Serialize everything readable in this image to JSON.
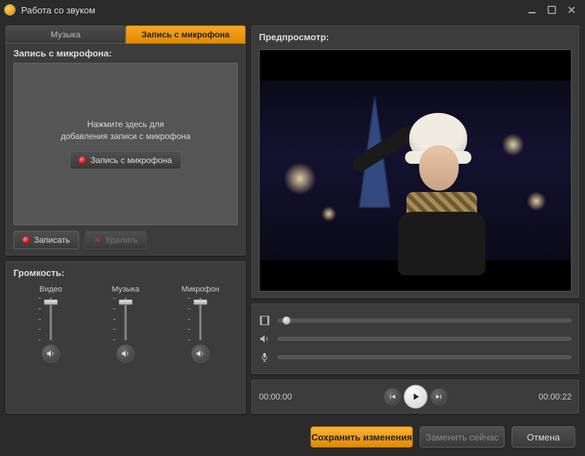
{
  "window": {
    "title": "Работа со звуком"
  },
  "tabs": {
    "music": "Музыка",
    "mic_record": "Запись с микрофона"
  },
  "record_panel": {
    "header": "Запись с микрофона:",
    "prompt_line1": "Нажмите здесь для",
    "prompt_line2": "добавления записи с микрофона",
    "record_button": "Запись с микрофона",
    "record_action": "Записать",
    "delete_action": "Удалить"
  },
  "volume_panel": {
    "header": "Громкость:",
    "video_label": "Видео",
    "music_label": "Музыка",
    "mic_label": "Микрофон"
  },
  "preview": {
    "header": "Предпросмотр:"
  },
  "transport": {
    "current_time": "00:00:00",
    "total_time": "00:00:22"
  },
  "footer": {
    "save": "Сохранить изменения",
    "replace_now": "Заменить сейчас",
    "cancel": "Отмена"
  }
}
